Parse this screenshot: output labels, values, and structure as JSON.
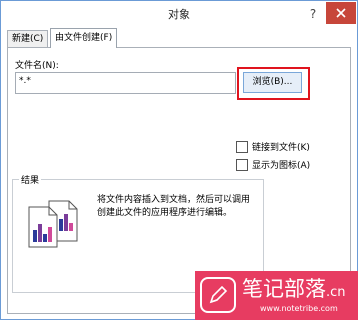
{
  "window": {
    "title": "对象",
    "help": "?"
  },
  "tabs": [
    {
      "label": "新建(C)"
    },
    {
      "label": "由文件创建(F)"
    }
  ],
  "file_name": {
    "label": "文件名(N):",
    "value": "*.*"
  },
  "browse_button": {
    "label": "浏览(B)..."
  },
  "checkboxes": [
    {
      "label": "链接到文件(K)",
      "checked": false
    },
    {
      "label": "显示为图标(A)",
      "checked": false
    }
  ],
  "result": {
    "title": "结果",
    "text": "将文件内容插入到文档，然后可以调用创建此文件的应用程序进行编辑。"
  },
  "watermark": {
    "title": "笔记部落",
    "suffix": ".cn",
    "url": "www.notetribe.com"
  },
  "colors": {
    "close_button": "#c7463a",
    "highlight_border": "#e0141e",
    "watermark_bg": "#e73c61"
  }
}
